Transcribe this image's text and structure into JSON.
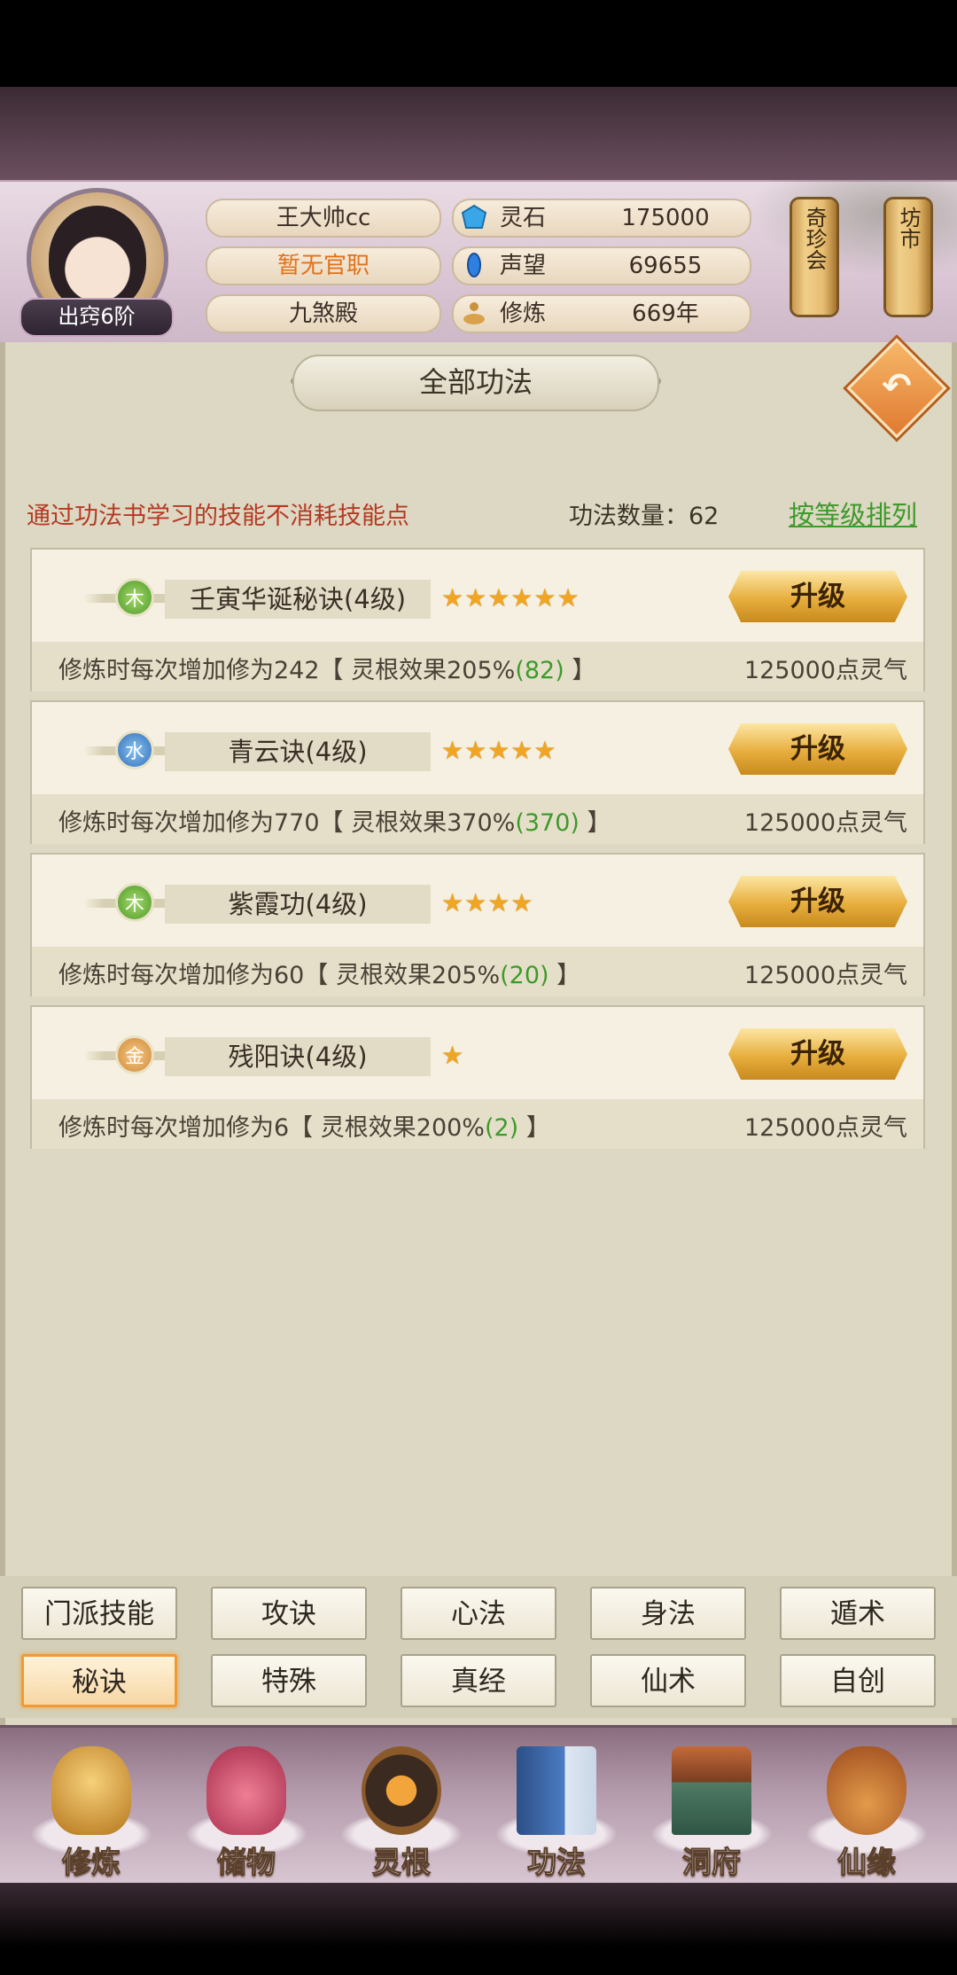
{
  "player": {
    "name": "王大帅cc",
    "title": "暂无官职",
    "sect": "九煞殿",
    "rank": "出窍6阶"
  },
  "resources": [
    {
      "label": "灵石",
      "value": "175000",
      "icon": "spirit-stone-icon"
    },
    {
      "label": "声望",
      "value": "69655",
      "icon": "prestige-icon"
    },
    {
      "label": "修炼",
      "value": "669年",
      "icon": "meditation-icon"
    }
  ],
  "scrolls": {
    "market_rare": "奇珍会",
    "market": "坊市"
  },
  "page": {
    "title": "全部功法"
  },
  "info": {
    "notice": "通过功法书学习的技能不消耗技能点",
    "count_label": "功法数量：62",
    "sort_label": "按等级排列"
  },
  "skills": [
    {
      "element": "木",
      "name": "壬寅华诞秘诀(4级)",
      "stars": 6,
      "button": "升级",
      "effect_prefix": "修炼时每次增加修为242【 灵根效果205%",
      "effect_bonus": "(82)",
      "effect_suffix": " 】",
      "cost": "125000点灵气"
    },
    {
      "element": "水",
      "name": "青云诀(4级)",
      "stars": 5,
      "button": "升级",
      "effect_prefix": "修炼时每次增加修为770【 灵根效果370%",
      "effect_bonus": "(370)",
      "effect_suffix": " 】",
      "cost": "125000点灵气"
    },
    {
      "element": "木",
      "name": "紫霞功(4级)",
      "stars": 4,
      "button": "升级",
      "effect_prefix": "修炼时每次增加修为60【 灵根效果205%",
      "effect_bonus": "(20)",
      "effect_suffix": " 】",
      "cost": "125000点灵气"
    },
    {
      "element": "金",
      "name": "残阳诀(4级)",
      "stars": 1,
      "button": "升级",
      "effect_prefix": "修炼时每次增加修为6【 灵根效果200%",
      "effect_bonus": "(2)",
      "effect_suffix": " 】",
      "cost": "125000点灵气"
    }
  ],
  "tabs": [
    [
      "门派技能",
      "攻诀",
      "心法",
      "身法",
      "遁术"
    ],
    [
      "秘诀",
      "特殊",
      "真经",
      "仙术",
      "自创"
    ]
  ],
  "active_tab": "秘诀",
  "bottom_nav": [
    {
      "label": "修炼",
      "icon": "meditating-figure-icon",
      "color": "#d7a64a"
    },
    {
      "label": "储物",
      "icon": "treasure-bag-icon",
      "color": "#c9486a"
    },
    {
      "label": "灵根",
      "icon": "spirit-root-icon",
      "color": "#7a4a2a"
    },
    {
      "label": "功法",
      "icon": "book-icon",
      "color": "#3a67a8"
    },
    {
      "label": "洞府",
      "icon": "pavilion-icon",
      "color": "#9a6a3a"
    },
    {
      "label": "仙缘",
      "icon": "gourd-icon",
      "color": "#c25a2a"
    }
  ],
  "colors": {
    "accent_green": "#3e9a2b",
    "notice_red": "#b53a24",
    "title_orange": "#e0721d",
    "star": "#f0a623"
  }
}
